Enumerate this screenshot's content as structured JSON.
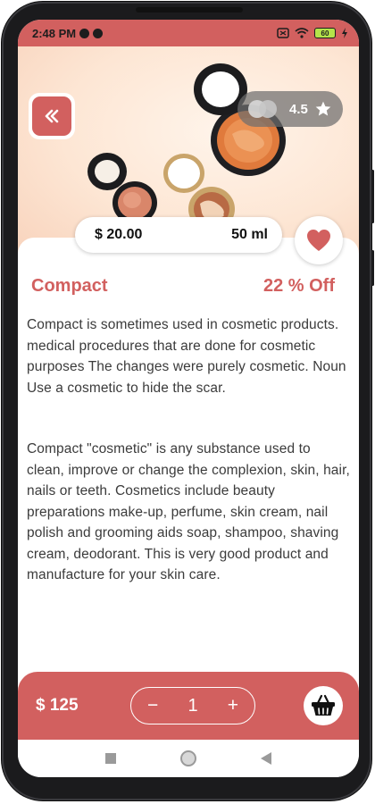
{
  "status_bar": {
    "time": "2:48 PM",
    "battery": "60"
  },
  "product": {
    "name": "Compact",
    "discount": "22 % Off",
    "price": "$ 20.00",
    "volume": "50 ml",
    "rating": "4.5",
    "description_1": "Compact is sometimes used in cosmetic products. medical procedures that are done for cosmetic purposes The changes were purely cosmetic. Noun Use a cosmetic to hide the scar.",
    "description_2": "Compact \"cosmetic\" is any substance used to clean, improve or change the complexion, skin, hair, nails or teeth. Cosmetics include beauty preparations make-up, perfume, skin cream, nail polish and grooming aids soap, shampoo, shaving cream, deodorant. This is very good product and manufacture for your skin care."
  },
  "cart": {
    "total": "$ 125",
    "minus": "−",
    "quantity": "1",
    "plus": "+"
  },
  "icons": {
    "back": "double-chevron-left-icon",
    "star": "star-icon",
    "favorite": "heart-icon",
    "basket": "basket-icon"
  },
  "colors": {
    "accent": "#d2605f",
    "rating_pill": "#6e6e6e"
  }
}
